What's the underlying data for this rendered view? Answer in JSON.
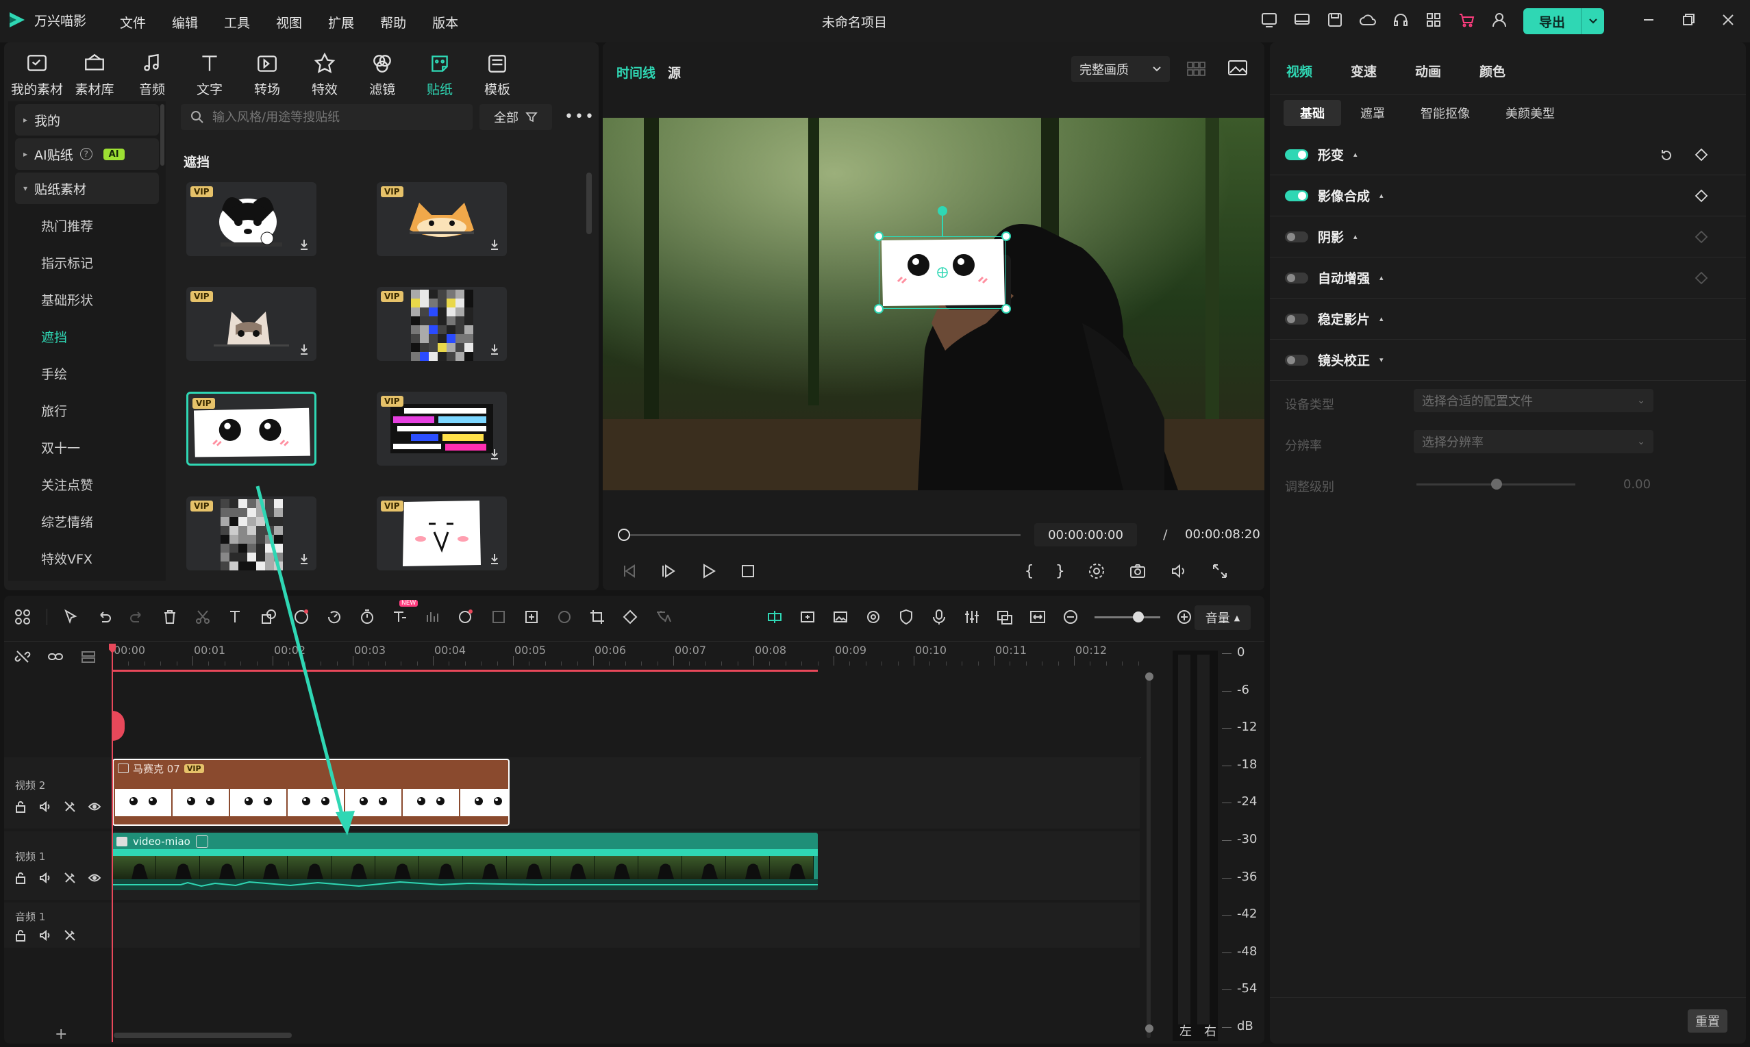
{
  "app": {
    "name": "万兴喵影",
    "project_title": "未命名项目",
    "export_label": "导出"
  },
  "menu": [
    "文件",
    "编辑",
    "工具",
    "视图",
    "扩展",
    "帮助",
    "版本"
  ],
  "toolbar_tabs": [
    {
      "label": "我的素材",
      "icon": "folder-icon"
    },
    {
      "label": "素材库",
      "icon": "library-icon"
    },
    {
      "label": "音频",
      "icon": "music-icon"
    },
    {
      "label": "文字",
      "icon": "text-icon"
    },
    {
      "label": "转场",
      "icon": "transition-icon"
    },
    {
      "label": "特效",
      "icon": "effects-icon"
    },
    {
      "label": "滤镜",
      "icon": "filter-icon"
    },
    {
      "label": "贴纸",
      "icon": "sticker-icon",
      "active": true
    },
    {
      "label": "模板",
      "icon": "template-icon"
    }
  ],
  "sidebar": {
    "groups": [
      "我的",
      "AI贴纸",
      "贴纸素材"
    ],
    "ai_badge": "AI",
    "categories": [
      "热门推荐",
      "指示标记",
      "基础形状",
      "遮挡",
      "手绘",
      "旅行",
      "双十一",
      "关注点赞",
      "综艺情绪",
      "特效VFX"
    ],
    "active_category": "遮挡"
  },
  "search": {
    "placeholder": "输入风格/用途等搜贴纸",
    "filter_label": "全部"
  },
  "section_title": "遮挡",
  "stickers": [
    {
      "name": "dog",
      "vip": "VIP"
    },
    {
      "name": "cat-orange",
      "vip": "VIP"
    },
    {
      "name": "cat-grey",
      "vip": "VIP"
    },
    {
      "name": "mosaic-color",
      "vip": "VIP"
    },
    {
      "name": "paper-eyes",
      "vip": "VIP",
      "selected": true
    },
    {
      "name": "glitch",
      "vip": "VIP"
    },
    {
      "name": "mosaic-grey",
      "vip": "VIP"
    },
    {
      "name": "ghost-face",
      "vip": "VIP"
    }
  ],
  "preview": {
    "tab_timeline": "时间线",
    "tab_source": "源",
    "quality": "完整画质",
    "current_time": "00:00:00:00",
    "separator": "/",
    "total_time": "00:00:08:20"
  },
  "right_panel": {
    "tabs": [
      "视频",
      "变速",
      "动画",
      "颜色"
    ],
    "subtabs": [
      "基础",
      "遮罩",
      "智能抠像",
      "美颜美型"
    ],
    "sections": [
      {
        "label": "形变",
        "on": true
      },
      {
        "label": "影像合成",
        "on": true
      },
      {
        "label": "阴影",
        "on": false
      },
      {
        "label": "自动增强",
        "on": false
      },
      {
        "label": "稳定影片",
        "on": false
      },
      {
        "label": "镜头校正",
        "on": false
      }
    ],
    "device_type_label": "设备类型",
    "device_type_placeholder": "选择合适的配置文件",
    "resolution_label": "分辨率",
    "resolution_placeholder": "选择分辨率",
    "level_label": "调整级别",
    "level_value": "0.00",
    "reset_label": "重置"
  },
  "timeline": {
    "volume_label": "音量",
    "new_badge": "NEW",
    "ruler": [
      "00:00",
      "00:01",
      "00:02",
      "00:03",
      "00:04",
      "00:05",
      "00:06",
      "00:07",
      "00:08",
      "00:09",
      "00:10",
      "00:11",
      "00:12"
    ],
    "tracks": [
      {
        "label": "视频 2"
      },
      {
        "label": "视频 1"
      },
      {
        "label": "音频 1"
      }
    ],
    "clip_sticker": {
      "name": "马赛克 07",
      "vip": "VIP"
    },
    "clip_video": {
      "name": "video-miao"
    },
    "add_track": "+"
  },
  "meter": {
    "scale": [
      "0",
      "-6",
      "-12",
      "-18",
      "-24",
      "-30",
      "-36",
      "-42",
      "-48",
      "-54",
      "dB"
    ],
    "left": "左",
    "right": "右"
  },
  "colors": {
    "accent": "#2fd7b4",
    "playhead": "#e8485a",
    "sticker_clip": "#8a4a2e",
    "video_clip": "#1f8f78"
  }
}
